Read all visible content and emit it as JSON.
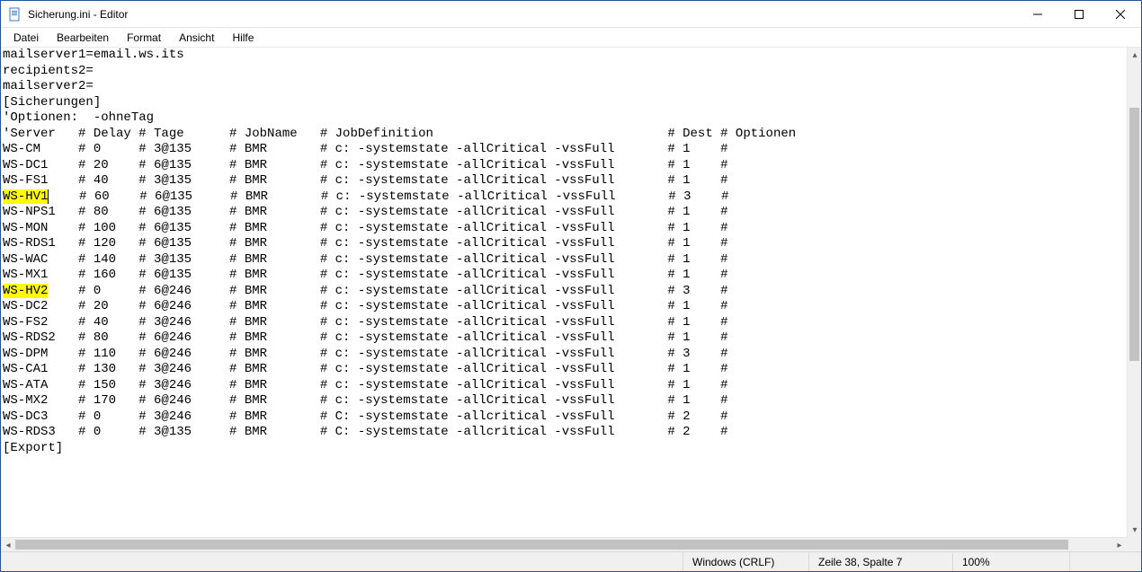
{
  "window": {
    "title": "Sicherung.ini - Editor"
  },
  "menu": {
    "file": "Datei",
    "edit": "Bearbeiten",
    "format": "Format",
    "view": "Ansicht",
    "help": "Hilfe"
  },
  "content": {
    "lines": [
      {
        "t": "mailserver1=email.ws.its"
      },
      {
        "t": "recipients2="
      },
      {
        "t": "mailserver2="
      },
      {
        "t": ""
      },
      {
        "t": "[Sicherungen]"
      },
      {
        "t": "'Optionen:  -ohneTag"
      },
      {
        "t": "'Server   # Delay # Tage      # JobName   # JobDefinition                               # Dest # Optionen"
      },
      {
        "t": "WS-CM     # 0     # 3@135     # BMR       # c: -systemstate -allCritical -vssFull       # 1    #"
      },
      {
        "t": "WS-DC1    # 20    # 6@135     # BMR       # c: -systemstate -allCritical -vssFull       # 1    #"
      },
      {
        "t": "WS-FS1    # 40    # 3@135     # BMR       # c: -systemstate -allCritical -vssFull       # 1    #"
      },
      {
        "hl": "WS-HV1",
        "caret_after_hl": true,
        "rest": "    # 60    # 6@135     # BMR       # c: -systemstate -allCritical -vssFull       # 3    #"
      },
      {
        "t": "WS-NPS1   # 80    # 6@135     # BMR       # c: -systemstate -allCritical -vssFull       # 1    #"
      },
      {
        "t": "WS-MON    # 100   # 6@135     # BMR       # c: -systemstate -allCritical -vssFull       # 1    #"
      },
      {
        "t": "WS-RDS1   # 120   # 6@135     # BMR       # c: -systemstate -allCritical -vssFull       # 1    #"
      },
      {
        "t": "WS-WAC    # 140   # 3@135     # BMR       # c: -systemstate -allCritical -vssFull       # 1    #"
      },
      {
        "t": "WS-MX1    # 160   # 6@135     # BMR       # c: -systemstate -allCritical -vssFull       # 1    #"
      },
      {
        "t": ""
      },
      {
        "hl": "WS-HV2",
        "rest": "    # 0     # 6@246     # BMR       # c: -systemstate -allCritical -vssFull       # 3    #"
      },
      {
        "t": "WS-DC2    # 20    # 6@246     # BMR       # c: -systemstate -allCritical -vssFull       # 1    #"
      },
      {
        "t": "WS-FS2    # 40    # 3@246     # BMR       # c: -systemstate -allCritical -vssFull       # 1    #"
      },
      {
        "t": "WS-RDS2   # 80    # 6@246     # BMR       # c: -systemstate -allCritical -vssFull       # 1    #"
      },
      {
        "t": "WS-DPM    # 110   # 6@246     # BMR       # c: -systemstate -allCritical -vssFull       # 3    #"
      },
      {
        "t": "WS-CA1    # 130   # 3@246     # BMR       # c: -systemstate -allCritical -vssFull       # 1    #"
      },
      {
        "t": "WS-ATA    # 150   # 3@246     # BMR       # c: -systemstate -allCritical -vssFull       # 1    #"
      },
      {
        "t": "WS-MX2    # 170   # 6@246     # BMR       # c: -systemstate -allCritical -vssFull       # 1    #"
      },
      {
        "t": ""
      },
      {
        "t": "WS-DC3    # 0     # 3@246     # BMR       # C: -systemstate -allcritical -vssFull       # 2    #"
      },
      {
        "t": "WS-RDS3   # 0     # 3@135     # BMR       # C: -systemstate -allcritical -vssFull       # 2    #"
      },
      {
        "t": ""
      },
      {
        "t": "[Export]"
      }
    ]
  },
  "status": {
    "encoding": "Windows (CRLF)",
    "position": "Zeile 38, Spalte 7",
    "zoom": "100%"
  }
}
